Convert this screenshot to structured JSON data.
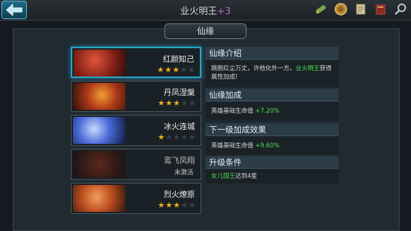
{
  "header": {
    "title": "业火明王",
    "title_suffix": "+3"
  },
  "toolbar_icons": [
    "scroll-icon",
    "medal-icon",
    "map-scroll-icon",
    "book-icon",
    "magnifier-icon"
  ],
  "panel": {
    "title": "仙缘"
  },
  "cards": [
    {
      "name": "红颜知己",
      "stars": 3,
      "active": true,
      "selected": true
    },
    {
      "name": "丹凤涅槃",
      "stars": 3,
      "active": true,
      "selected": false
    },
    {
      "name": "冰火连城",
      "stars": 1,
      "active": true,
      "selected": false
    },
    {
      "name": "鸾飞凤翔",
      "stars": 0,
      "active": false,
      "status": "未激活",
      "selected": false
    },
    {
      "name": "烈火燎原",
      "stars": 3,
      "active": true,
      "selected": false
    }
  ],
  "detail": {
    "intro": {
      "title": "仙缘介绍",
      "text_before": "跳脱红尘万丈，许他化外一方。",
      "hero": "业火明王",
      "text_after": "获得属性加成!"
    },
    "bonus": {
      "title": "仙缘加成",
      "label": "英雄基础生命值",
      "value": "+7.20%"
    },
    "next_bonus": {
      "title": "下一级加成效果",
      "label": "英雄基础生命值",
      "value": "+9.60%"
    },
    "upgrade": {
      "title": "升级条件",
      "hero": "女儿国王",
      "text": "达到4星"
    }
  },
  "colors": {
    "accent": "#2aa6c8",
    "star": "#f0b020",
    "green": "#4ee04e",
    "plus": "#c06ad0"
  }
}
